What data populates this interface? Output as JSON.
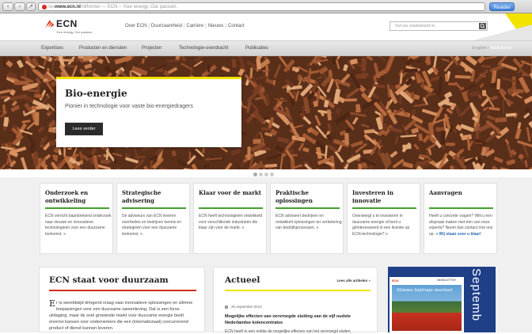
{
  "browser": {
    "url_host": "www.ecn.nl",
    "url_path": "/nl/home/",
    "url_title": " — ECN – Your energy. Our passion.",
    "reader_label": "Reader"
  },
  "header": {
    "logo": "ECN",
    "tagline": "Your energy. Our passion.",
    "topnav": [
      "Over ECN",
      "Duurzaamheid",
      "Carrière",
      "Nieuws",
      "Contact"
    ],
    "search_placeholder": "Vul uw zoekwoord in"
  },
  "mainnav": {
    "items": [
      "Expertises",
      "Producten en diensten",
      "Projecten",
      "Technologie-overdracht",
      "Publicaties"
    ],
    "lang_en": "English",
    "lang_sep": " / ",
    "lang_nl": "Nederlands"
  },
  "hero": {
    "title": "Bio-energie",
    "subtitle": "Pionier in technologie voor vaste bio-energiedragers",
    "button": "Lees verder"
  },
  "cards": [
    {
      "title": "Onderzoek en ontwikkeling",
      "body": "ECN verricht baanbrekend onderzoek naar nieuwe en innovatieve technologieën voor een duurzame toekomst.",
      "arrow": "»"
    },
    {
      "title": "Strategische advisering",
      "body": "De adviseurs van ECN leveren overheden en bedrijven kennis en strategieën voor een duurzame toekomst.",
      "arrow": "»"
    },
    {
      "title": "Klaar voor de markt",
      "body": "ECN heeft technologieën ontwikkeld voor verschillende industrieën die klaar zijn voor de markt.",
      "arrow": "»"
    },
    {
      "title": "Praktische oplossingen",
      "body": "ECN adviseert bedrijven en ontwikkelt oplossingen ter verbetering van bedrijfsprocessen.",
      "arrow": "»"
    },
    {
      "title": "Investeren in innovatie",
      "body": "Overweegt u te investeren in duurzame energie of bent u geïnteresseerd in een licentie op ECN-technologie?",
      "arrow": "»"
    },
    {
      "title": "Aanvragen",
      "body": "Heeft u concrete vragen? Wilt u een afspraak maken met één van onze experts? Neem dan contact met ons op.",
      "link": "Wij staan voor u klaar!",
      "arrow": "»"
    }
  ],
  "duurzaam": {
    "title": "ECN staat voor duurzaam",
    "drop": "E",
    "text": "r is wereldwijd dringend vraag naar innovatieve oplossingen en slimme toepassingen voor een duurzame samenleving. Dat is een forse uitdaging, maar de snel groeiende markt voor duurzame energie biedt enorme kansen voor ondernemers die een (internationaal) concurrerend product of dienst kunnen leveren."
  },
  "actueel": {
    "title": "Actueel",
    "more": "Lees alle artikelen",
    "date": "26 september 2013",
    "headline": "Mogelijke effecten van vervroegde sluiting van de vijf oudste Nederlandse kolencentrales",
    "body": "ECN heeft in een notitie de mogelijke effecten van het vervroegd sluiten"
  },
  "promo": {
    "vertical": "Septemb",
    "nl_logo": "ECN",
    "nl_title": "NEWSLETTER",
    "nl_head": "Slimme bijdrage meetnet"
  }
}
